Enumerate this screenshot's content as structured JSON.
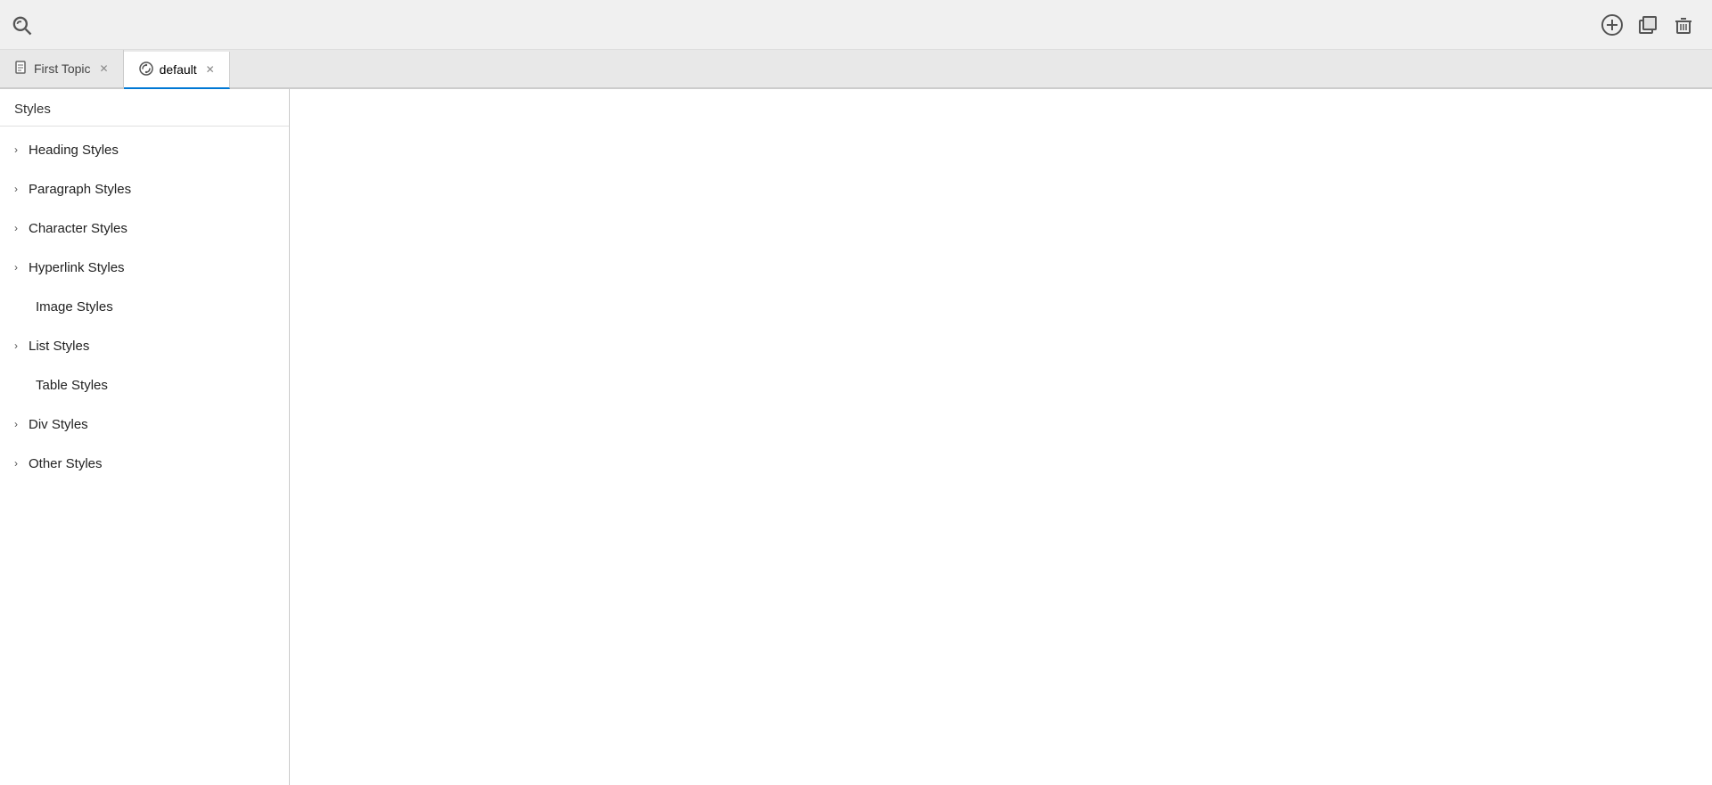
{
  "toolbar": {
    "add_label": "+",
    "copy_label": "⧉",
    "delete_label": "🗑"
  },
  "tabs": [
    {
      "id": "first-topic",
      "label": "First Topic",
      "icon": "document-icon",
      "active": false,
      "closable": true
    },
    {
      "id": "default",
      "label": "default",
      "icon": "styles-icon",
      "active": true,
      "closable": true
    }
  ],
  "styles_panel": {
    "header": "Styles",
    "items": [
      {
        "id": "heading-styles",
        "label": "Heading Styles",
        "has_chevron": true,
        "expanded": false
      },
      {
        "id": "paragraph-styles",
        "label": "Paragraph Styles",
        "has_chevron": true,
        "expanded": false
      },
      {
        "id": "character-styles",
        "label": "Character Styles",
        "has_chevron": true,
        "expanded": false
      },
      {
        "id": "hyperlink-styles",
        "label": "Hyperlink Styles",
        "has_chevron": true,
        "expanded": false
      },
      {
        "id": "image-styles",
        "label": "Image Styles",
        "has_chevron": false,
        "expanded": false
      },
      {
        "id": "list-styles",
        "label": "List Styles",
        "has_chevron": true,
        "expanded": false
      },
      {
        "id": "table-styles",
        "label": "Table Styles",
        "has_chevron": false,
        "expanded": false
      },
      {
        "id": "div-styles",
        "label": "Div Styles",
        "has_chevron": true,
        "expanded": false
      },
      {
        "id": "other-styles",
        "label": "Other Styles",
        "has_chevron": true,
        "expanded": false
      }
    ]
  }
}
